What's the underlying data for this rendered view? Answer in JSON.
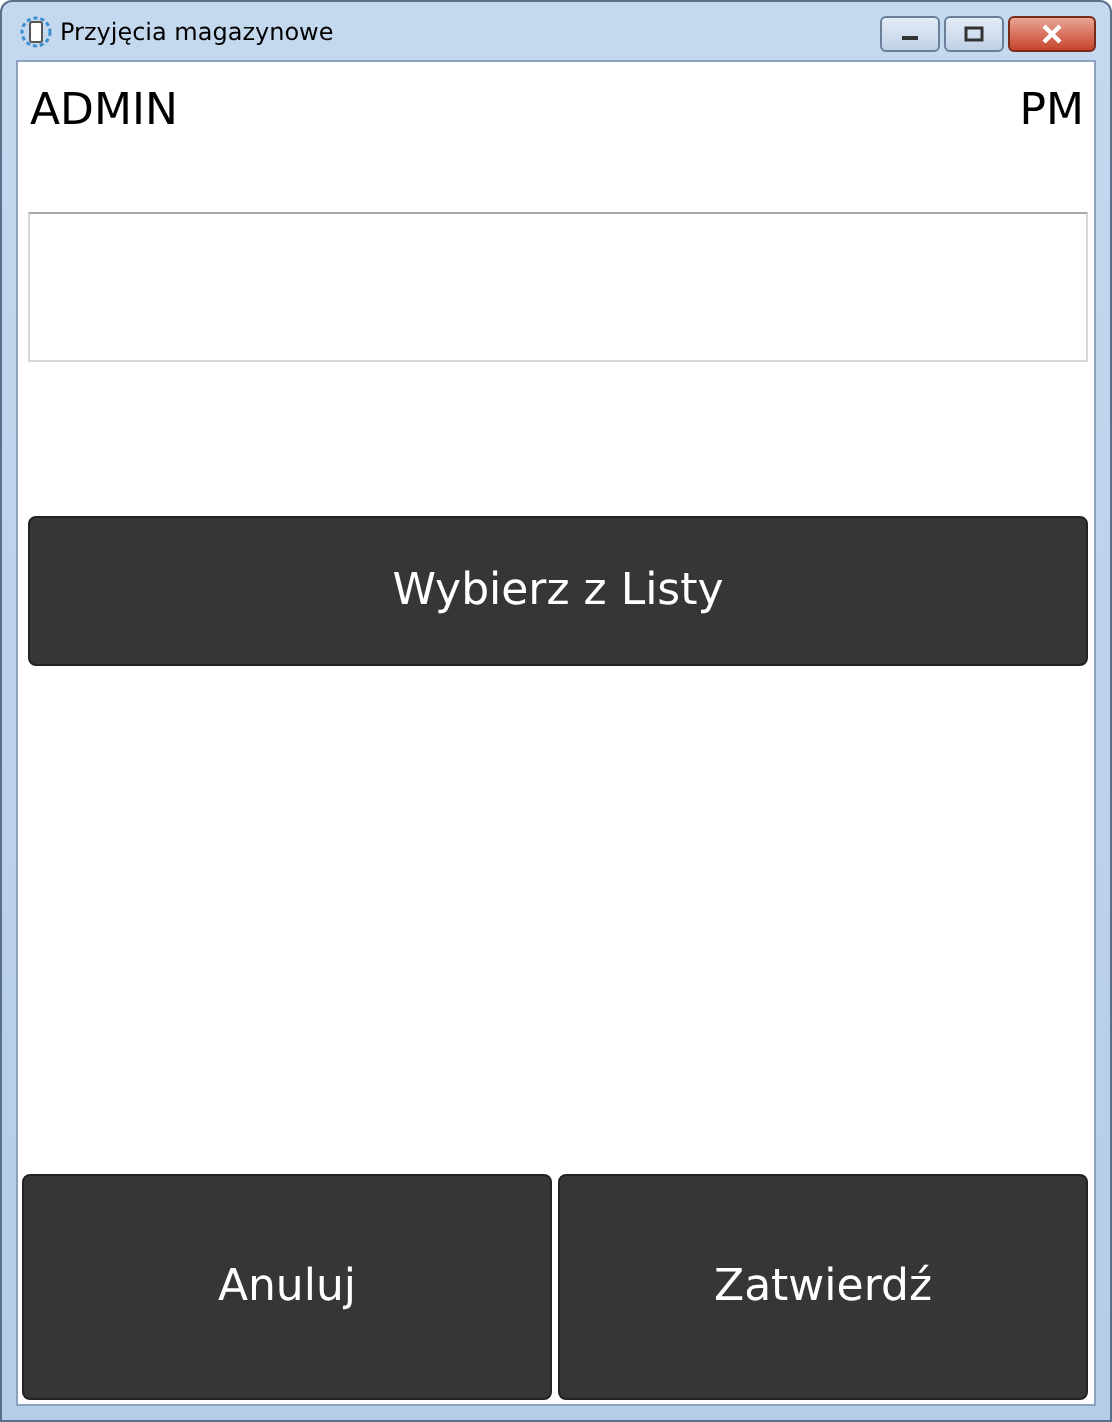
{
  "window": {
    "title": "Przyjęcia magazynowe"
  },
  "header": {
    "user": "ADMIN",
    "code": "PM"
  },
  "select_button": {
    "label": "Wybierz z Listy"
  },
  "buttons": [
    {
      "label": "Anuluj"
    },
    {
      "label": "Zatwierdź"
    }
  ]
}
